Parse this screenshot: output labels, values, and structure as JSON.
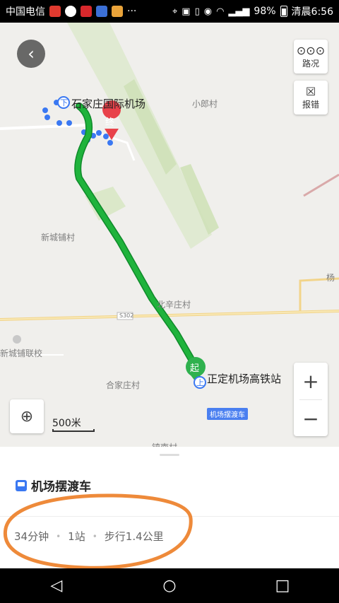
{
  "statusbar": {
    "carrier": "中国电信",
    "ellipsis": "···",
    "battery": "98%",
    "time": "清晨6:56"
  },
  "map": {
    "labels": {
      "airport": "石家庄国际机场",
      "xiaolang": "小郎村",
      "xinchengpu": "新城铺村",
      "beixin": "北辛庄村",
      "yang": "杨",
      "xinchengpu_school": "新城铺联校",
      "hejiazhuang": "合家庄村",
      "zhengding_station": "正定机场高铁站",
      "zhennan": "镇南村",
      "road_code": "S302"
    },
    "markers": {
      "start": "起",
      "end": "终",
      "board": "上",
      "alight": "下"
    },
    "route_tag": "机场摆渡车",
    "buttons": {
      "traffic": "路况",
      "report": "报错"
    },
    "scale": "500米",
    "route_color": "#1fb33c"
  },
  "panel": {
    "title": "机场摆渡车",
    "summary": {
      "duration": "34分钟",
      "stops": "1站",
      "walk": "步行1.4公里"
    }
  }
}
